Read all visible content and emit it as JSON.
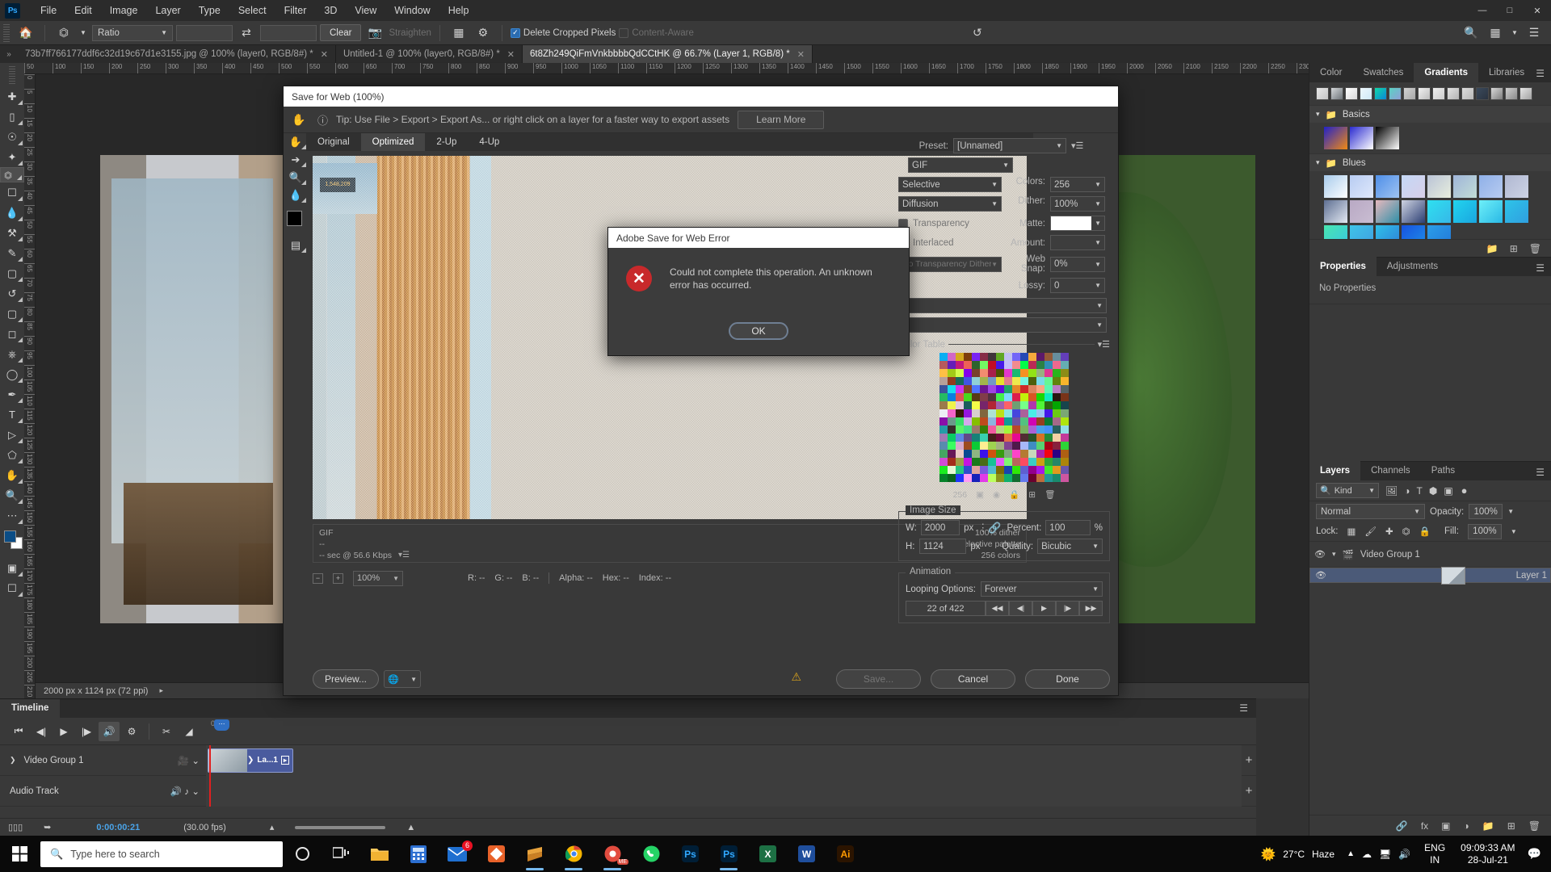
{
  "app": {
    "name": "Adobe Photoshop",
    "logo": "Ps"
  },
  "menubar": {
    "items": [
      "File",
      "Edit",
      "Image",
      "Layer",
      "Type",
      "Select",
      "Filter",
      "3D",
      "View",
      "Window",
      "Help"
    ],
    "window_controls": [
      "minimize",
      "maximize",
      "close"
    ]
  },
  "options_bar": {
    "home_icon": "home-icon",
    "tool_icon": "crop-tool-icon",
    "ratio_select": "Ratio",
    "width_value": "",
    "height_value": "",
    "swap_icon": "swap-icon",
    "clear_label": "Clear",
    "straighten_label": "Straighten",
    "overlay_icon": "grid-overlay-icon",
    "settings_icon": "gear-icon",
    "delete_cropped_label": "Delete Cropped Pixels",
    "delete_cropped_checked": true,
    "content_aware_label": "Content-Aware",
    "reset_icon": "reset-icon"
  },
  "document_tabs": [
    {
      "label": "73b7ff766177ddf6c32d19c67d1e3155.jpg @ 100% (layer0, RGB/8#) *",
      "active": false
    },
    {
      "label": "Untitled-1 @ 100% (layer0, RGB/8#) *",
      "active": false
    },
    {
      "label": "6t8Zh249QiFmVnkbbbbQdCCtHK @ 66.7% (Layer 1, RGB/8) *",
      "active": true
    }
  ],
  "tools": [
    "move-tool",
    "marquee-tool",
    "lasso-tool",
    "quick-select-tool",
    "crop-tool",
    "frame-tool",
    "eyedropper-tool",
    "healing-brush-tool",
    "brush-tool",
    "clone-stamp-tool",
    "history-brush-tool",
    "eraser-tool",
    "gradient-tool",
    "blur-tool",
    "dodge-tool",
    "pen-tool",
    "type-tool",
    "path-selection-tool",
    "shape-tool",
    "hand-tool",
    "zoom-tool",
    "more-tools",
    "edit-toolbar"
  ],
  "canvas": {
    "status_dimensions": "2000 px x 1124 px (72 ppi)",
    "ruler_units": "px"
  },
  "save_for_web": {
    "title": "Save for Web (100%)",
    "tip_icon": "info-icon",
    "tip_text": "Tip: Use File > Export > Export As...  or right click on a layer for a faster way to export assets",
    "learn_more": "Learn More",
    "view_tabs": [
      "Original",
      "Optimized",
      "2-Up",
      "4-Up"
    ],
    "active_view_tab": "Optimized",
    "info": {
      "format": "GIF",
      "size": "--",
      "speed": "-- sec @ 56.6 Kbps",
      "dither": "100% dither",
      "palette": "Selective palette",
      "colors": "256 colors"
    },
    "zoom_value": "100%",
    "readouts": {
      "r": "R: --",
      "g": "G: --",
      "b": "B: --",
      "alpha": "Alpha: --",
      "hex": "Hex: --",
      "index": "Index: --"
    },
    "preset_label": "Preset:",
    "preset_value": "[Unnamed]",
    "format_value": "GIF",
    "reduction_value": "Selective",
    "dither_algorithm_value": "Diffusion",
    "transparency_label": "Transparency",
    "interlaced_label": "Interlaced",
    "transparency_dither_value": "No Transparency Dither",
    "colors_label": "Colors:",
    "colors_value": "256",
    "dither_label": "Dither:",
    "dither_value": "100%",
    "matte_label": "Matte:",
    "matte_color": "#ffffff",
    "amount_label": "Amount:",
    "amount_value": "",
    "web_snap_label": "Web Snap:",
    "web_snap_value": "0%",
    "lossy_label": "Lossy:",
    "lossy_value": "0",
    "color_table_legend": "Color Table",
    "color_table_count": "256",
    "image_size_legend": "Image Size",
    "width_label": "W:",
    "width_value": "2000",
    "height_label": "H:",
    "height_value": "1124",
    "px_unit": "px",
    "percent_label": "Percent:",
    "percent_value": "100",
    "percent_unit": "%",
    "quality_label": "Quality:",
    "quality_value": "Bicubic",
    "animation_legend": "Animation",
    "looping_label": "Looping Options:",
    "looping_value": "Forever",
    "frame_counter": "22 of 422",
    "nav_buttons": [
      "first-frame",
      "previous-frame",
      "play",
      "next-frame",
      "last-frame"
    ],
    "preview_label": "Preview...",
    "save_label": "Save...",
    "cancel_label": "Cancel",
    "done_label": "Done",
    "warning_icon": "warning-icon"
  },
  "error_dialog": {
    "title": "Adobe Save for Web Error",
    "icon": "error-icon",
    "message": "Could not complete this operation. An unknown error has occurred.",
    "ok_label": "OK"
  },
  "right_dock": {
    "top_panel": {
      "tabs": [
        "Color",
        "Swatches",
        "Gradients",
        "Libraries"
      ],
      "active_tab": "Gradients",
      "menu_icon": "panel-menu-icon",
      "groups": [
        {
          "name": "Basics",
          "expanded": true
        },
        {
          "name": "Blues",
          "expanded": true
        }
      ],
      "footer_icons": [
        "new-group-icon",
        "new-gradient-icon",
        "delete-icon"
      ]
    },
    "properties_panel": {
      "tabs": [
        "Properties",
        "Adjustments"
      ],
      "active_tab": "Properties",
      "empty_text": "No Properties",
      "menu_icon": "panel-menu-icon"
    },
    "layers_panel": {
      "tabs": [
        "Layers",
        "Channels",
        "Paths"
      ],
      "active_tab": "Layers",
      "menu_icon": "panel-menu-icon",
      "filter_label": "Kind",
      "filter_icons": [
        "pixel-filter-icon",
        "adjustment-filter-icon",
        "type-filter-icon",
        "shape-filter-icon",
        "smart-object-filter-icon"
      ],
      "filter_toggle": "filter-toggle-icon",
      "blend_mode": "Normal",
      "opacity_label": "Opacity:",
      "opacity_value": "100%",
      "lock_label": "Lock:",
      "lock_icons": [
        "lock-transparent-icon",
        "lock-image-icon",
        "lock-position-icon",
        "lock-artboard-icon",
        "lock-all-icon"
      ],
      "fill_label": "Fill:",
      "fill_value": "100%",
      "rows": [
        {
          "name": "Video Group 1",
          "type": "group",
          "visible": true,
          "selected": false
        },
        {
          "name": "Layer 1",
          "type": "video",
          "visible": true,
          "selected": true
        }
      ],
      "footer_icons": [
        "link-icon",
        "fx-icon",
        "mask-icon",
        "adjustment-icon",
        "group-icon",
        "new-layer-icon",
        "delete-layer-icon"
      ]
    }
  },
  "timeline": {
    "tab_label": "Timeline",
    "transport_icons": [
      "go-to-first-frame",
      "previous-frame",
      "play",
      "next-frame",
      "mute-audio",
      "settings"
    ],
    "edit_icons": [
      "split-clip-icon",
      "transition-icon"
    ],
    "tracks": [
      {
        "name": "Video Group 1",
        "icon": "film-strip-icon"
      },
      {
        "name": "Audio Track",
        "icon": "music-note-icon"
      }
    ],
    "clip_label": "La...1",
    "time_marker": "0",
    "current_time": "0:00:00:21",
    "fps": "(30.00 fps)",
    "add_track_icon": "plus-icon",
    "footer_icons": [
      "convert-frames-icon",
      "render-video-icon"
    ]
  },
  "taskbar": {
    "search_placeholder": "Type here to search",
    "search_icon": "search-icon",
    "start_icon": "windows-start-icon",
    "cortana_icon": "cortana-icon",
    "taskview_icon": "task-view-icon",
    "apps": [
      "file-explorer-icon",
      "calculator-icon",
      "mail-icon",
      "powerpoint-icon",
      "sublime-icon",
      "chrome-icon",
      "chrome-me-icon",
      "whatsapp-icon",
      "photoshop-icon",
      "photoshop-icon-2",
      "excel-icon",
      "word-icon",
      "illustrator-icon"
    ],
    "mail_badge": "6",
    "weather_temp": "27°C",
    "weather_desc": "Haze",
    "weather_icon": "haze-icon",
    "tray_icons": [
      "chevron-up-icon",
      "onedrive-icon",
      "network-icon",
      "volume-icon"
    ],
    "language": "ENG",
    "region": "IN",
    "time": "09:09:33 AM",
    "date": "28-Jul-21",
    "notification_icon": "notification-icon"
  },
  "colors": {
    "accent": "#31a8ff",
    "panel_bg": "#393939",
    "canvas_bg": "#282828",
    "error_red": "#c8292b",
    "playhead_red": "#e02020",
    "selection_blue": "#4b5a78"
  }
}
